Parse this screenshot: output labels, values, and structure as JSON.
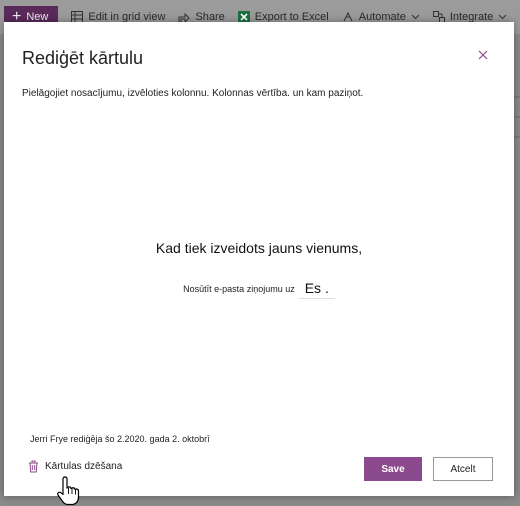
{
  "toolbar": {
    "new_label": "New",
    "edit_grid_label": "Edit in grid view",
    "share_label": "Share",
    "export_label": "Export to Excel",
    "automate_label": "Automate",
    "integrate_label": "Integrate"
  },
  "dialog": {
    "title": "Rediģēt kārtulu",
    "description": "Pielāgojiet nosacījumu, izvēloties kolonnu. Kolonnas vērtība. un kam paziņot.",
    "condition_text": "Kad tiek izveidots jauns vienums,",
    "action_text": "Nosūtīt e-pasta ziņojumu uz",
    "recipient": "Es .",
    "edited_info": "Jerri Frye rediģēja šo 2.2020. gada 2. oktobrī",
    "delete_label": "Kārtulas dzēšana",
    "save_label": "Save",
    "cancel_label": "Atcelt"
  },
  "colors": {
    "accent": "#8b4a8e",
    "new_button": "#5a2a5a",
    "excel_icon": "#1d6f42"
  },
  "icons": [
    "plus-icon",
    "grid-icon",
    "share-icon",
    "excel-icon",
    "automate-icon",
    "integrate-icon",
    "close-icon",
    "trash-icon",
    "hand-cursor-icon"
  ]
}
